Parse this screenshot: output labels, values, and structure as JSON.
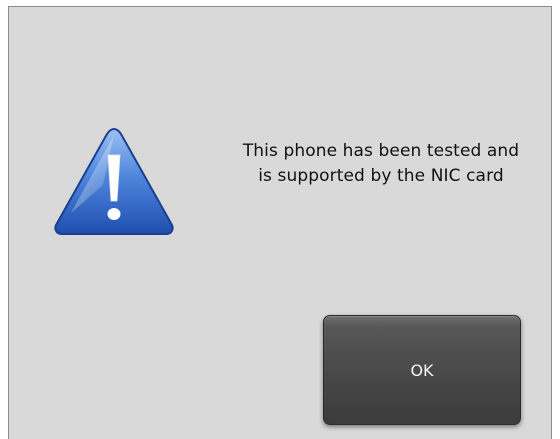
{
  "dialog": {
    "icon": "warning-icon",
    "message_line1": "This phone has been tested and",
    "message_line2": "is supported by the NIC card",
    "ok_label": "OK"
  },
  "colors": {
    "background": "#d9d9d9",
    "icon_blue": "#2d63c8",
    "button_dark": "#484848"
  }
}
